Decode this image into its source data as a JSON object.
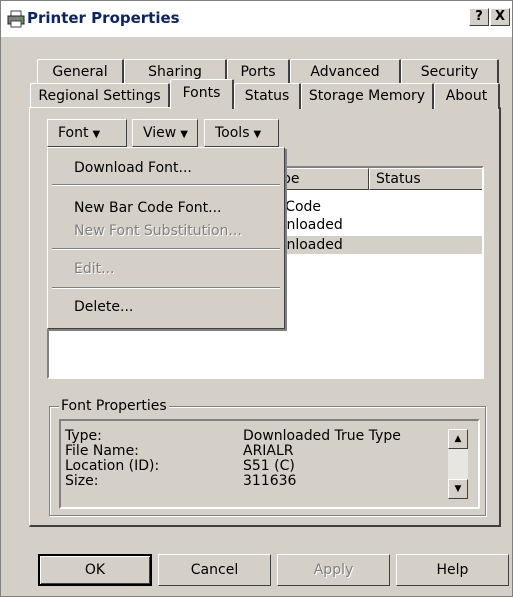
{
  "window": {
    "title": "Printer Properties",
    "help_label": "?",
    "close_label": "X"
  },
  "tabs_top": [
    "General",
    "Sharing",
    "Ports",
    "Advanced",
    "Security"
  ],
  "tabs_bottom": [
    "Regional Settings",
    "Fonts",
    "Status",
    "Storage Memory",
    "About"
  ],
  "active_tab": "Fonts",
  "menubar": {
    "font": "Font",
    "view": "View",
    "tools": "Tools"
  },
  "font_menu": {
    "download_font": "Download Font...",
    "new_barcode_font": "New Bar Code Font...",
    "new_font_substitution": "New Font Substitution...",
    "edit": "Edit...",
    "delete": "Delete..."
  },
  "list": {
    "col_type": "pe",
    "col_status": "Status",
    "rows": [
      "r Code",
      "wnloaded",
      "wnloaded"
    ]
  },
  "font_properties": {
    "title": "Font Properties",
    "type_label": "Type:",
    "type_value": "Downloaded True Type",
    "file_label": "File Name:",
    "file_value": "ARIALR",
    "location_label": "Location (ID):",
    "location_value": "S51 (C)",
    "size_label": "Size:",
    "size_value": "311636"
  },
  "buttons": {
    "ok": "OK",
    "cancel": "Cancel",
    "apply": "Apply",
    "help": "Help"
  }
}
